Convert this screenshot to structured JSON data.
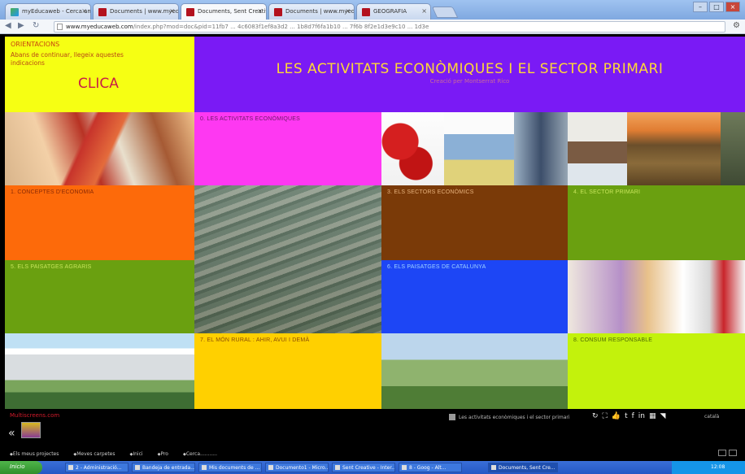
{
  "browser": {
    "tabs": [
      {
        "label": "myEducaweb - Cerca amb ..."
      },
      {
        "label": "Documents | www.myeduca..."
      },
      {
        "label": "Documents, Sent Creative C..."
      },
      {
        "label": "Documents | www.myeduca..."
      },
      {
        "label": "GEOGRAFIA"
      }
    ],
    "active_tab": 2,
    "url_host": "www.myeducaweb.com",
    "url_rest": "/index.php?mod=doc&pid=11fb7 ... 4c6083f1ef8a3d2 ... 1b8d7f6fa1b10 ... 7f6b 8f2e1d3e9c10 ... 1d3e"
  },
  "orientacions": {
    "heading": "ORIENTACIONS",
    "text": "Abans de continuar, llegeix aquestes indicacions",
    "clica": "CLICA"
  },
  "banner": {
    "title": "LES ACTIVITATS ECONÒMIQUES I EL SECTOR PRIMARI",
    "subtitle": "Creació per Montserrat Rico"
  },
  "sections": [
    {
      "label": "0. LES ACTIVITATS ECONÒMIQUES",
      "color": "#fe38f2"
    },
    {
      "label": "1. CONCEPTES D'ECONOMIA",
      "color": "#fd6a0a"
    },
    {
      "label": "3. ELS SECTORS ECONÒMICS",
      "color": "#7a3a08"
    },
    {
      "label": "4. EL SECTOR PRIMARI",
      "color": "#6aa010"
    },
    {
      "label": "5. ELS PAISATGES AGRARIS",
      "color": "#6aa010"
    },
    {
      "label": "6. ELS PAISATGES DE CATALUNYA",
      "color": "#1d46f5"
    },
    {
      "label": "7. EL MÓN RURAL : AHIR, AVUI I DEMÀ",
      "color": "#ffd000"
    },
    {
      "label": "8. CONSUM RESPONSABLE",
      "color": "#c3f20c"
    }
  ],
  "footer": {
    "brand": "Multiscreens.com",
    "now_playing": "Les activitats econòmiques i el sector primari",
    "icons": [
      "refresh-icon",
      "fullscreen-icon",
      "like-icon",
      "share-icon",
      "facebook-icon",
      "linkedin-icon",
      "print-icon",
      "rss-icon"
    ],
    "language": "català",
    "bottom_nav": [
      "Els meus projectes",
      "Meves carpetes",
      "Inici",
      "Pro",
      "Cerca..........."
    ]
  },
  "taskbar": {
    "start": "Inicio",
    "tasks": [
      "2 - Administració...",
      "Bandeja de entrada...",
      "Mis documents de ...",
      "Documento1 - Micro...",
      "Sent Creative - Inter...",
      "8 - Goog - Alt...",
      "Documents, Sent Cre..."
    ],
    "clock": "12:08"
  }
}
